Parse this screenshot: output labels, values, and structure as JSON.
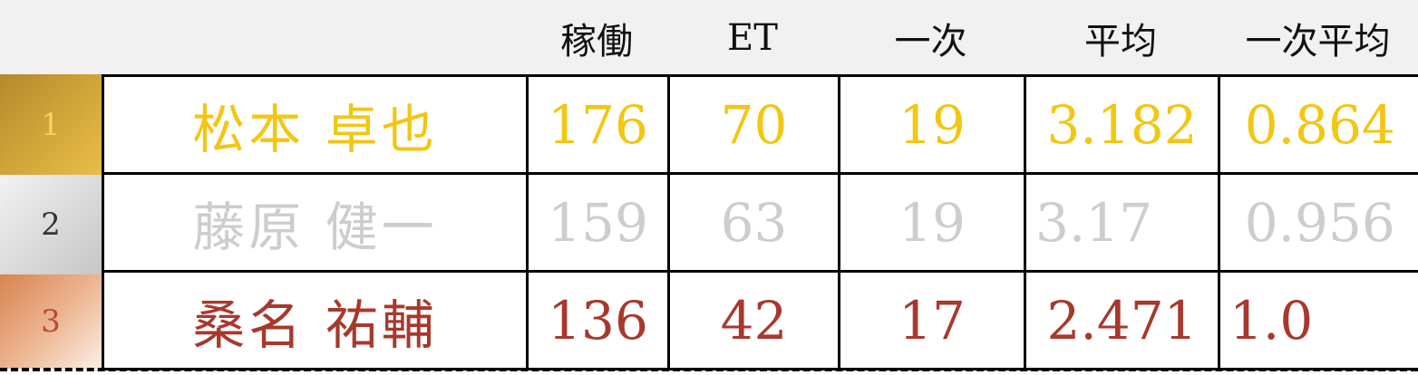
{
  "headers": [
    "稼働",
    "ET",
    "一次",
    "平均",
    "一次平均"
  ],
  "rows": [
    {
      "rank": "1",
      "name": "松本 卓也",
      "values": [
        "176",
        "70",
        "19",
        "3.182",
        "0.864"
      ]
    },
    {
      "rank": "2",
      "name": "藤原 健一",
      "values": [
        "159",
        "63",
        "19",
        "3.17",
        "0.956"
      ]
    },
    {
      "rank": "3",
      "name": "桑名 祐輔",
      "values": [
        "136",
        "42",
        "17",
        "2.471",
        "1.0"
      ]
    }
  ],
  "colors": {
    "gold": "#f2c613",
    "silver": "#cdcdcd",
    "bronze": "#a8382d",
    "header_bg": "#f1f1f1",
    "border": "#000000"
  }
}
